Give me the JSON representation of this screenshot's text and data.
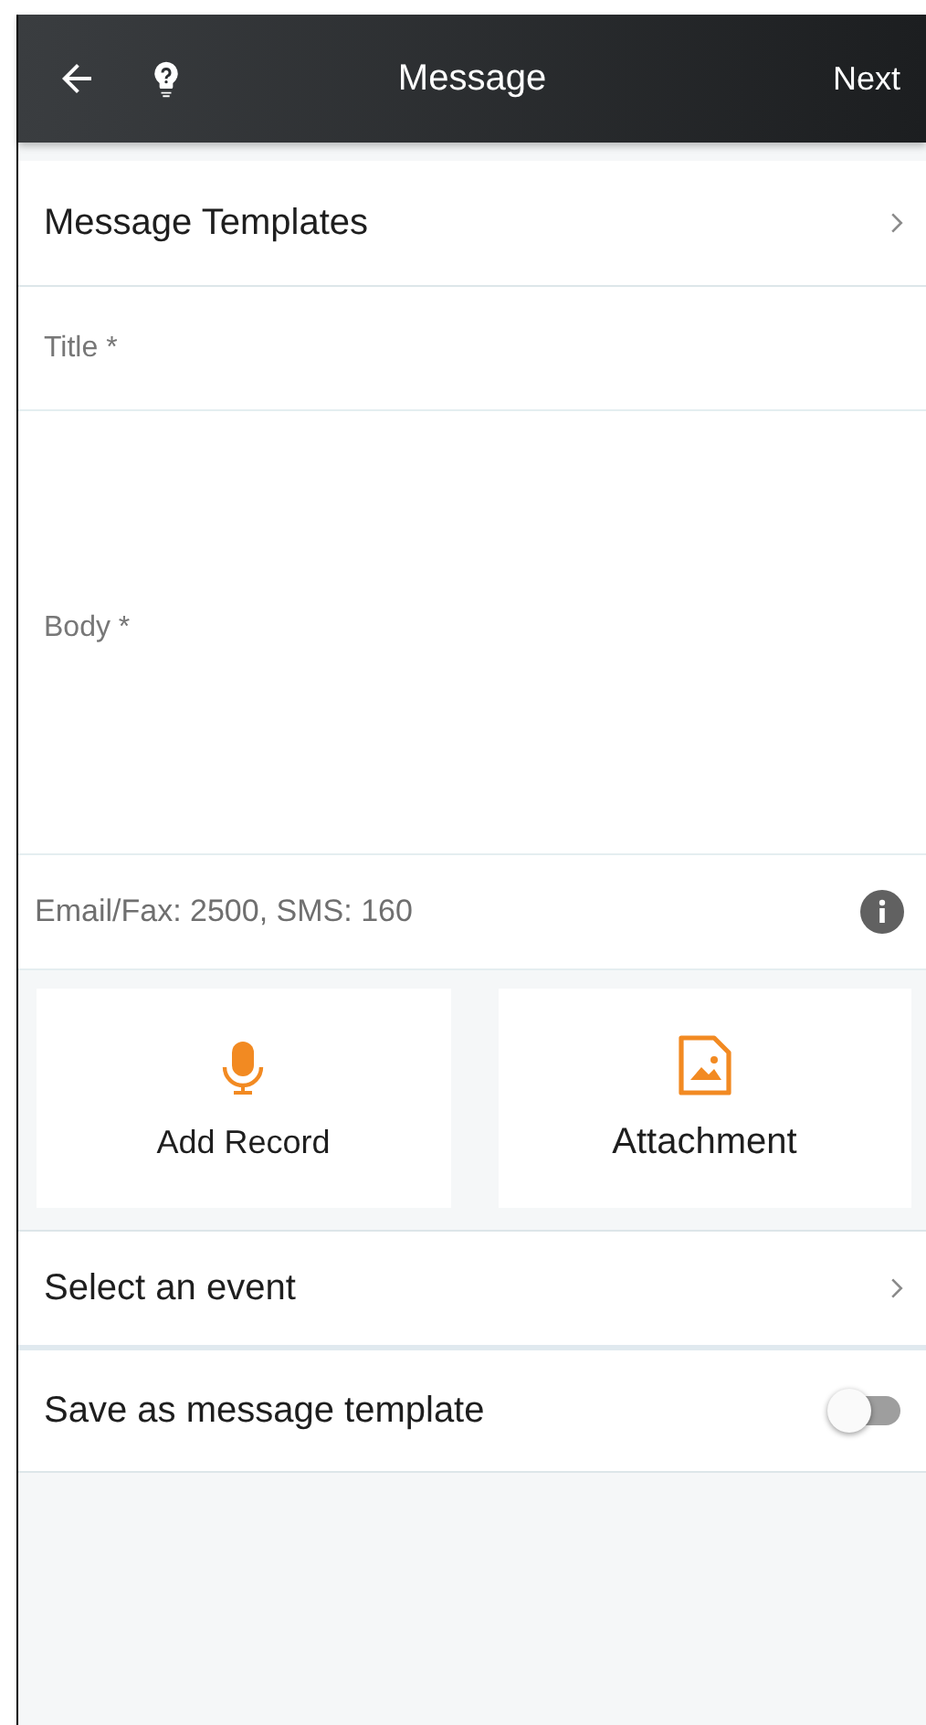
{
  "header": {
    "title": "Message",
    "next": "Next"
  },
  "templates_row": {
    "label": "Message Templates"
  },
  "title_field": {
    "placeholder": "Title *"
  },
  "body_field": {
    "placeholder": "Body *"
  },
  "limits": {
    "text": "Email/Fax: 2500, SMS: 160"
  },
  "actions": [
    {
      "kind": "record",
      "label": "Add Record"
    },
    {
      "kind": "attachment",
      "label": "Attachment"
    }
  ],
  "event_row": {
    "label": "Select an event"
  },
  "save_template": {
    "label": "Save as message template",
    "on": false
  }
}
